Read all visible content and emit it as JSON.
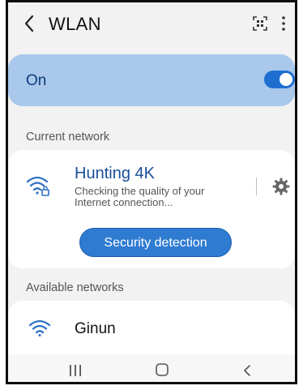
{
  "header": {
    "title": "WLAN",
    "back_icon": "chevron-left-icon",
    "qr_icon": "qr-scan-icon",
    "more_icon": "more-vertical-icon"
  },
  "wlan_toggle": {
    "label": "On",
    "state": "on",
    "accent": "#1f6fd1",
    "card_color": "#a9c8ec"
  },
  "current_network": {
    "section_label": "Current network",
    "name": "Hunting 4K",
    "status": "Checking the quality of your Internet connection...",
    "icon": "wifi-lock-icon",
    "settings_icon": "gear-icon",
    "button_label": "Security detection"
  },
  "available_networks": {
    "section_label": "Available networks",
    "items": [
      {
        "name": "Ginun",
        "icon": "wifi-icon"
      }
    ]
  },
  "navbar": {
    "recent_icon": "recent-apps-icon",
    "home_icon": "home-icon",
    "back_icon": "back-icon"
  }
}
